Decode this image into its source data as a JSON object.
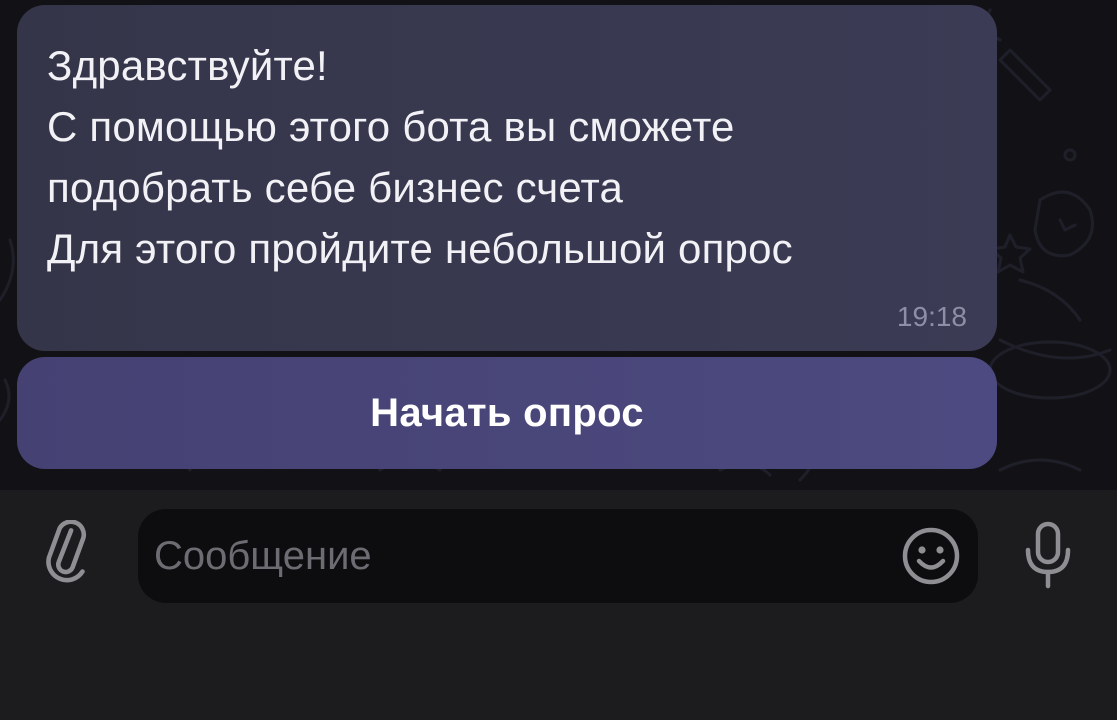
{
  "chat": {
    "message": {
      "lines": [
        "Здравствуйте!",
        "С помощью этого бота вы сможете",
        "подобрать себе бизнес счета",
        "Для этого пройдите небольшой опрос"
      ],
      "time": "19:18"
    },
    "inline_button": {
      "label": "Начать опрос"
    }
  },
  "input_bar": {
    "placeholder": "Сообщение",
    "value": "",
    "icons": {
      "attach": "paperclip-icon",
      "emoji": "smiley-icon",
      "mic": "microphone-icon"
    }
  },
  "colors": {
    "chat_background": "#121216",
    "bubble": "#393950",
    "inline_button": "#4a4679",
    "input_bar": "#1c1c1e",
    "icon": "#8e8e93"
  }
}
